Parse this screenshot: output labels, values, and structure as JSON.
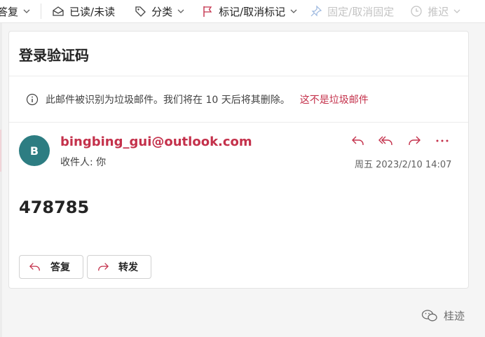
{
  "toolbar": {
    "reply_label": "答复",
    "read_unread_label": "已读/未读",
    "categorize_label": "分类",
    "flag_label": "标记/取消标记",
    "pin_label": "固定/取消固定",
    "snooze_label": "推迟"
  },
  "message": {
    "subject": "登录验证码",
    "junk_notice": "此邮件被识别为垃圾邮件。我们将在 10 天后将其删除。",
    "not_junk_link": "这不是垃圾邮件",
    "avatar_initial": "B",
    "sender": "bingbing_gui@outlook.com",
    "to_line": "收件人: 你",
    "date": "周五 2023/2/10 14:07",
    "body_code": "478785",
    "reply_button": "答复",
    "forward_button": "转发"
  },
  "watermark": {
    "text": "桂迹"
  },
  "colors": {
    "accent": "#c4314b",
    "avatar": "#2d7d82",
    "disabled": "#c4c4c4"
  },
  "icons": [
    "reply-icon",
    "envelope-open-icon",
    "tag-icon",
    "flag-icon",
    "pin-icon",
    "clock-icon",
    "info-icon",
    "reply-all-icon",
    "forward-icon",
    "more-icon",
    "chevron-down-icon",
    "wechat-icon"
  ]
}
